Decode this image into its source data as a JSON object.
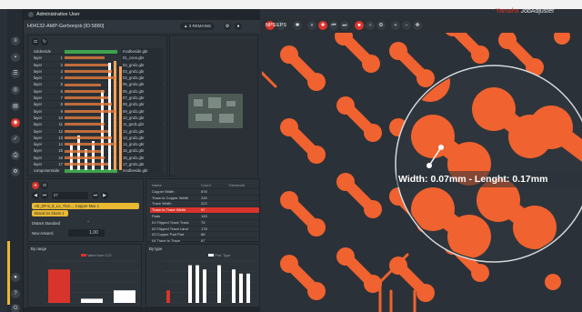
{
  "app": {
    "user_label": "Administrative User",
    "brand_prefix": "Yamaha",
    "brand_name": "JobAdjuster",
    "accent": "#d9342b"
  },
  "job": {
    "title": "H04132-AMP-Gerbonjob [ID:5880]",
    "remains_label": "3 REMAINS"
  },
  "layer_table": {
    "rows": [
      {
        "name": "solderside",
        "num": "",
        "file": "modbeside.gbr"
      },
      {
        "name": "layer",
        "num": "1",
        "file": "01_cooo.gbr"
      },
      {
        "name": "layer",
        "num": "2",
        "file": "02_gnd1.gbr"
      },
      {
        "name": "layer",
        "num": "3",
        "file": "03_gnd1.gbr"
      },
      {
        "name": "layer",
        "num": "4",
        "file": "04_gnd1.gbr"
      },
      {
        "name": "layer",
        "num": "5",
        "file": "05_gnd1.gbr"
      },
      {
        "name": "layer",
        "num": "6",
        "file": "06_gnd1.gbr"
      },
      {
        "name": "layer",
        "num": "7",
        "file": "07_gnd1.gbr"
      },
      {
        "name": "layer",
        "num": "8",
        "file": "08_gnd1.gbr"
      },
      {
        "name": "layer",
        "num": "9",
        "file": "09_gnd1.gbr"
      },
      {
        "name": "layer",
        "num": "10",
        "file": "10_gnd1.gbr"
      },
      {
        "name": "layer",
        "num": "11",
        "file": "11_gnd1.gbr"
      },
      {
        "name": "layer",
        "num": "12",
        "file": "12_gnd1.gbr"
      },
      {
        "name": "layer",
        "num": "13",
        "file": "13_gnd1.gbr"
      },
      {
        "name": "layer",
        "num": "14",
        "file": "14_gnd1.gbr"
      },
      {
        "name": "layer",
        "num": "15",
        "file": "15_gnd1.gbr"
      },
      {
        "name": "layer",
        "num": "16",
        "file": "16_gnd1.gbr"
      },
      {
        "name": "layer",
        "num": "17",
        "file": "17_gnd1.gbr"
      },
      {
        "name": "componentside",
        "num": "",
        "file": "modbeside.gbr"
      }
    ]
  },
  "tool": {
    "page_value": "27",
    "field_1": "Ab_DF-5_8_Lo_Ylv2..., Copper Max 1",
    "field_2": "Brand 54 Sbars 1",
    "label_1": "Distant Standard",
    "label_2": "New Antarcti",
    "stepper_value": "1.00"
  },
  "result_table": {
    "headers": [
      "Name",
      "Count",
      "Threshold"
    ],
    "rows": [
      {
        "name": "Copper Width",
        "count": "876",
        "th": ""
      },
      {
        "name": "Trace to Copper Width",
        "count": "245",
        "th": ""
      },
      {
        "name": "Trace Width",
        "count": "222",
        "th": ""
      },
      {
        "name": "Trace to Trace Width",
        "count": "97",
        "th": "",
        "selected": true
      },
      {
        "name": "Pads",
        "count": "145",
        "th": ""
      },
      {
        "name": "01 Flipped Trace Trace",
        "count": "75",
        "th": ""
      },
      {
        "name": "02 Flipped Trace Land",
        "count": "178",
        "th": ""
      },
      {
        "name": "03 Copper Pad Pad",
        "count": "88",
        "th": ""
      },
      {
        "name": "04 Trace to Trace",
        "count": "87",
        "th": ""
      }
    ]
  },
  "chart_range": {
    "title": "By range",
    "legend": "Value from 0.22",
    "chart_data": {
      "type": "bar",
      "categories": [
        "",
        "",
        ""
      ],
      "values": [
        8,
        1,
        3
      ],
      "ylim": [
        0,
        10
      ],
      "color": "#d9342b"
    }
  },
  "chart_type": {
    "title": "By type",
    "legend": "Prot. Type",
    "chart_data": {
      "type": "bar",
      "values": [
        3,
        0,
        0,
        9,
        9,
        8,
        0,
        9,
        0,
        8,
        7,
        7
      ],
      "ylim": [
        0,
        10
      ]
    }
  },
  "measurement": {
    "text": "Width: 0.07mm - Lenght: 0.17mm"
  },
  "viewer_toolbar": {
    "btn_1": "NPS",
    "btn_2": "EPS"
  }
}
